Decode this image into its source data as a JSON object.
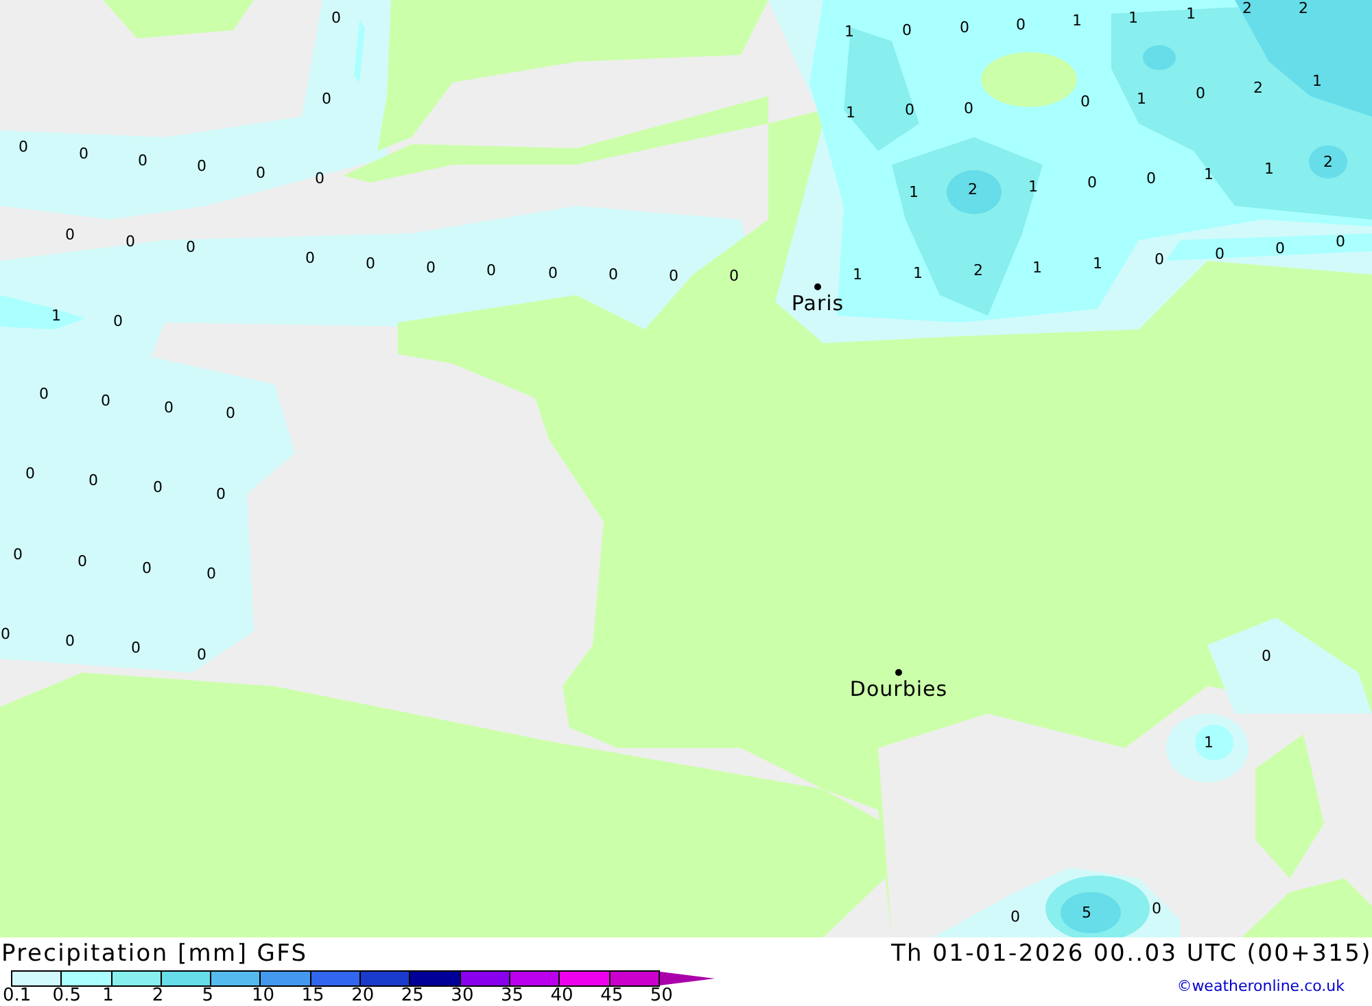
{
  "map": {
    "values": [
      "0",
      "0",
      "0",
      "0",
      "0",
      "0",
      "0",
      "0",
      "0",
      "0",
      "0",
      "0",
      "0",
      "0",
      "0",
      "0",
      "0",
      "0",
      "0",
      "1",
      "0",
      "0",
      "0",
      "0",
      "0",
      "0",
      "0",
      "0",
      "0",
      "0",
      "0",
      "0",
      "0",
      "0",
      "0",
      "0",
      "0",
      "1",
      "0",
      "0",
      "0",
      "1",
      "1",
      "1",
      "2",
      "2",
      "1",
      "0",
      "0",
      "0",
      "1",
      "0",
      "2",
      "1",
      "1",
      "2",
      "1",
      "0",
      "0",
      "1",
      "1",
      "2",
      "1",
      "1",
      "2",
      "1",
      "1",
      "0",
      "0",
      "0",
      "0",
      "0",
      "1",
      "0",
      "5",
      "0"
    ],
    "cities": [
      {
        "name": "Paris"
      },
      {
        "name": "Dourbies"
      }
    ]
  },
  "title": "Precipitation [mm] GFS",
  "valid_time": "Th 01-01-2026 00..03 UTC (00+315)",
  "legend": [
    {
      "label": "0.1",
      "color": "#d2fafa"
    },
    {
      "label": "0.5",
      "color": "#aaffff"
    },
    {
      "label": "1",
      "color": "#88eeee"
    },
    {
      "label": "2",
      "color": "#66dde9"
    },
    {
      "label": "5",
      "color": "#55bbee"
    },
    {
      "label": "10",
      "color": "#4499ee"
    },
    {
      "label": "15",
      "color": "#3366ee"
    },
    {
      "label": "20",
      "color": "#1a3ccc"
    },
    {
      "label": "25",
      "color": "#000099"
    },
    {
      "label": "30",
      "color": "#8800ee"
    },
    {
      "label": "35",
      "color": "#bb00ee"
    },
    {
      "label": "40",
      "color": "#ee00ee"
    },
    {
      "label": "45",
      "color": "#cc00cc"
    },
    {
      "label": "50",
      "color": "#aa00aa"
    }
  ],
  "credit": "©weatheronline.co.uk"
}
